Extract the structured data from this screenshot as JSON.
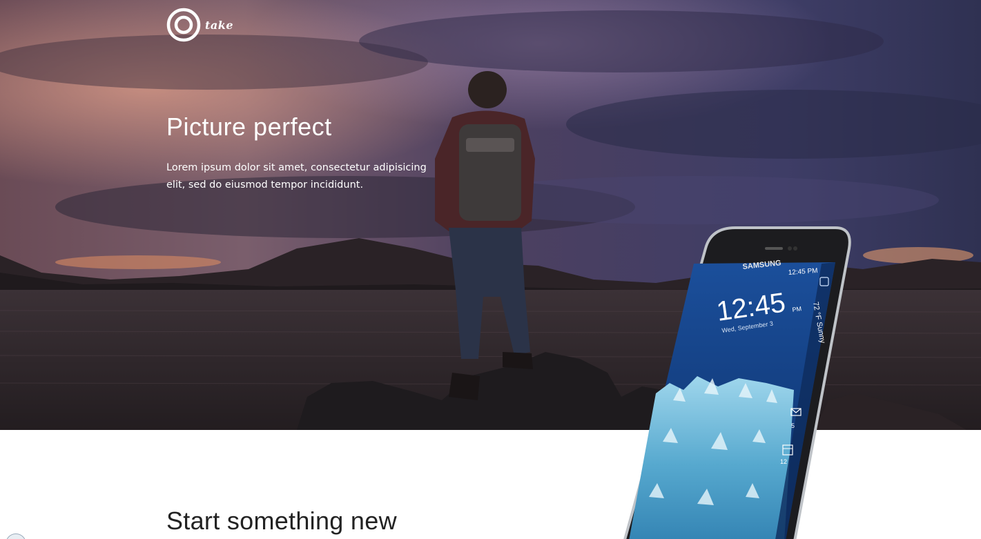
{
  "logo": {
    "text": "take",
    "icon": "target-ring-icon"
  },
  "hero": {
    "title": "Picture perfect",
    "subtitle": "Lorem ipsum dolor sit amet, consectetur adipisicing elit, sed do eiusmod tempor incididunt."
  },
  "phone": {
    "brand": "SAMSUNG",
    "status_time": "12:45 PM",
    "clock": "12:45",
    "clock_suffix": "PM",
    "date": "Wed, September 3",
    "weather": "72 °F Sunny",
    "edge_count_1": "5",
    "edge_count_2": "12"
  },
  "section": {
    "title": "Start something new"
  },
  "colors": {
    "accent": "#ffffff",
    "text_dark": "#222222"
  }
}
